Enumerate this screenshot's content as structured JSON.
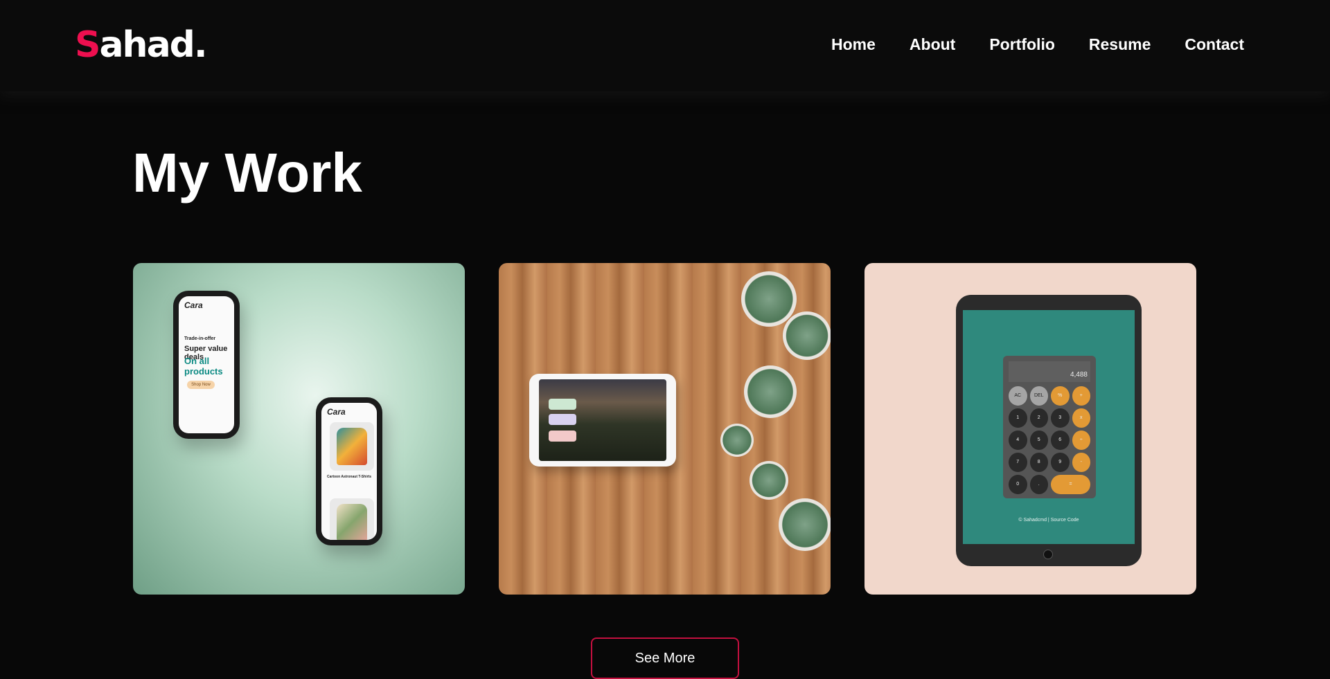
{
  "header": {
    "logo_initial": "S",
    "logo_rest": "ahad.",
    "nav": [
      "Home",
      "About",
      "Portfolio",
      "Resume",
      "Contact"
    ]
  },
  "main": {
    "heading": "My Work",
    "projects": [
      {
        "mock": "ecommerce-phones",
        "brand": "Cara",
        "tagline_small": "Trade-in-offer",
        "tagline_1": "Super value deals",
        "tagline_2": "On all products",
        "cta": "Shop Now",
        "product_name": "Cartoon Astronaut T-Shirts"
      },
      {
        "mock": "farm-dashboard-tablet"
      },
      {
        "mock": "calculator-ipad",
        "display": "4,488",
        "keys": [
          "AC",
          "DEL",
          "%",
          "+",
          "1",
          "2",
          "3",
          "x",
          "4",
          "5",
          "6",
          "÷",
          "7",
          "8",
          "9",
          "-",
          "0",
          ".",
          "="
        ],
        "footer": "© Sahadcmd  |  Source Code"
      }
    ],
    "see_more": "See More"
  },
  "colors": {
    "accent": "#ee0f4f",
    "background": "#080808",
    "button_border": "#c4103f"
  }
}
